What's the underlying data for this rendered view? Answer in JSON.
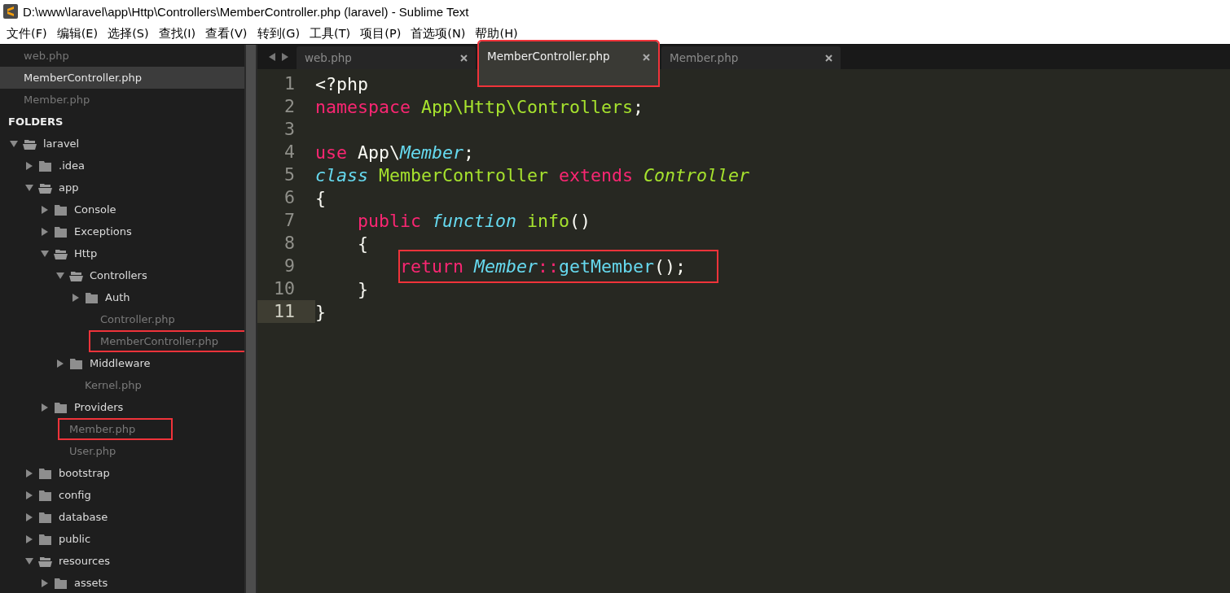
{
  "window": {
    "title": "D:\\www\\laravel\\app\\Http\\Controllers\\MemberController.php (laravel) - Sublime Text"
  },
  "menu": [
    "文件(F)",
    "编辑(E)",
    "选择(S)",
    "查找(I)",
    "查看(V)",
    "转到(G)",
    "工具(T)",
    "项目(P)",
    "首选项(N)",
    "帮助(H)"
  ],
  "sidebar": {
    "open_files": [
      {
        "label": "web.php",
        "selected": false,
        "annotated": false
      },
      {
        "label": "MemberController.php",
        "selected": true,
        "annotated": false
      },
      {
        "label": "Member.php",
        "selected": false,
        "annotated": false
      }
    ],
    "folders_heading": "FOLDERS",
    "tree": [
      {
        "label": "laravel",
        "kind": "folder",
        "expanded": true,
        "annotated": false,
        "children": [
          {
            "label": ".idea",
            "kind": "folder",
            "expanded": false,
            "annotated": false
          },
          {
            "label": "app",
            "kind": "folder",
            "expanded": true,
            "annotated": false,
            "children": [
              {
                "label": "Console",
                "kind": "folder",
                "expanded": false,
                "annotated": false
              },
              {
                "label": "Exceptions",
                "kind": "folder",
                "expanded": false,
                "annotated": false
              },
              {
                "label": "Http",
                "kind": "folder",
                "expanded": true,
                "annotated": false,
                "children": [
                  {
                    "label": "Controllers",
                    "kind": "folder",
                    "expanded": true,
                    "annotated": false,
                    "children": [
                      {
                        "label": "Auth",
                        "kind": "folder",
                        "expanded": false,
                        "annotated": false
                      },
                      {
                        "label": "Controller.php",
                        "kind": "file",
                        "annotated": false
                      },
                      {
                        "label": "MemberController.php",
                        "kind": "file",
                        "annotated": true
                      }
                    ]
                  },
                  {
                    "label": "Middleware",
                    "kind": "folder",
                    "expanded": false,
                    "annotated": false
                  },
                  {
                    "label": "Kernel.php",
                    "kind": "file",
                    "annotated": false
                  }
                ]
              },
              {
                "label": "Providers",
                "kind": "folder",
                "expanded": false,
                "annotated": false
              },
              {
                "label": "Member.php",
                "kind": "file",
                "annotated": true
              },
              {
                "label": "User.php",
                "kind": "file",
                "annotated": false
              }
            ]
          },
          {
            "label": "bootstrap",
            "kind": "folder",
            "expanded": false,
            "annotated": false
          },
          {
            "label": "config",
            "kind": "folder",
            "expanded": false,
            "annotated": false
          },
          {
            "label": "database",
            "kind": "folder",
            "expanded": false,
            "annotated": false
          },
          {
            "label": "public",
            "kind": "folder",
            "expanded": false,
            "annotated": false
          },
          {
            "label": "resources",
            "kind": "folder",
            "expanded": true,
            "annotated": false,
            "children": [
              {
                "label": "assets",
                "kind": "folder",
                "expanded": false,
                "annotated": false
              }
            ]
          }
        ]
      }
    ]
  },
  "tabs": [
    {
      "label": "web.php",
      "selected": false,
      "annotated": false
    },
    {
      "label": "MemberController.php",
      "selected": true,
      "annotated": true
    },
    {
      "label": "Member.php",
      "selected": false,
      "annotated": false
    }
  ],
  "editor": {
    "lines": [
      {
        "number": "1",
        "current": false,
        "annotated": false,
        "tokens": [
          {
            "t": "<?php",
            "kind": "plain"
          }
        ]
      },
      {
        "number": "2",
        "current": false,
        "annotated": false,
        "tokens": [
          {
            "t": "namespace",
            "kind": "keyword"
          },
          {
            "t": " App\\Http\\Controllers",
            "kind": "name"
          },
          {
            "t": ";",
            "kind": "plain"
          }
        ]
      },
      {
        "number": "3",
        "current": false
      },
      {
        "number": "4",
        "current": false,
        "annotated": false,
        "tokens": [
          {
            "t": "use",
            "kind": "keyword"
          },
          {
            "t": " App\\",
            "kind": "plain"
          },
          {
            "t": "Member",
            "kind": "type"
          },
          {
            "t": ";",
            "kind": "plain"
          }
        ]
      },
      {
        "number": "5",
        "current": false,
        "annotated": false,
        "tokens": [
          {
            "t": "class",
            "kind": "storage"
          },
          {
            "t": " MemberController",
            "kind": "name"
          },
          {
            "t": " extends",
            "kind": "keyword"
          },
          {
            "t": " Controller",
            "kind": "inherit"
          }
        ]
      },
      {
        "number": "6",
        "current": false,
        "annotated": false,
        "tokens": [
          {
            "t": "{",
            "kind": "plain"
          }
        ]
      },
      {
        "number": "7",
        "current": false,
        "annotated": false,
        "tokens": [
          {
            "t": "    public",
            "kind": "keyword"
          },
          {
            "t": " function",
            "kind": "storage"
          },
          {
            "t": " info",
            "kind": "name"
          },
          {
            "t": "()",
            "kind": "plain"
          }
        ]
      },
      {
        "number": "8",
        "current": false,
        "annotated": false,
        "tokens": [
          {
            "t": "    {",
            "kind": "plain"
          }
        ]
      },
      {
        "number": "9",
        "current": false,
        "annotated": true,
        "tokens": [
          {
            "t": "        return",
            "kind": "keyword"
          },
          {
            "t": " Member",
            "kind": "type"
          },
          {
            "t": "::",
            "kind": "keyword"
          },
          {
            "t": "getMember",
            "kind": "func"
          },
          {
            "t": "();",
            "kind": "plain"
          }
        ]
      },
      {
        "number": "10",
        "current": false,
        "annotated": false,
        "tokens": [
          {
            "t": "    }",
            "kind": "plain"
          }
        ]
      },
      {
        "number": "11",
        "current": true,
        "annotated": false,
        "tokens": [
          {
            "t": "}",
            "kind": "plain"
          }
        ]
      }
    ]
  }
}
